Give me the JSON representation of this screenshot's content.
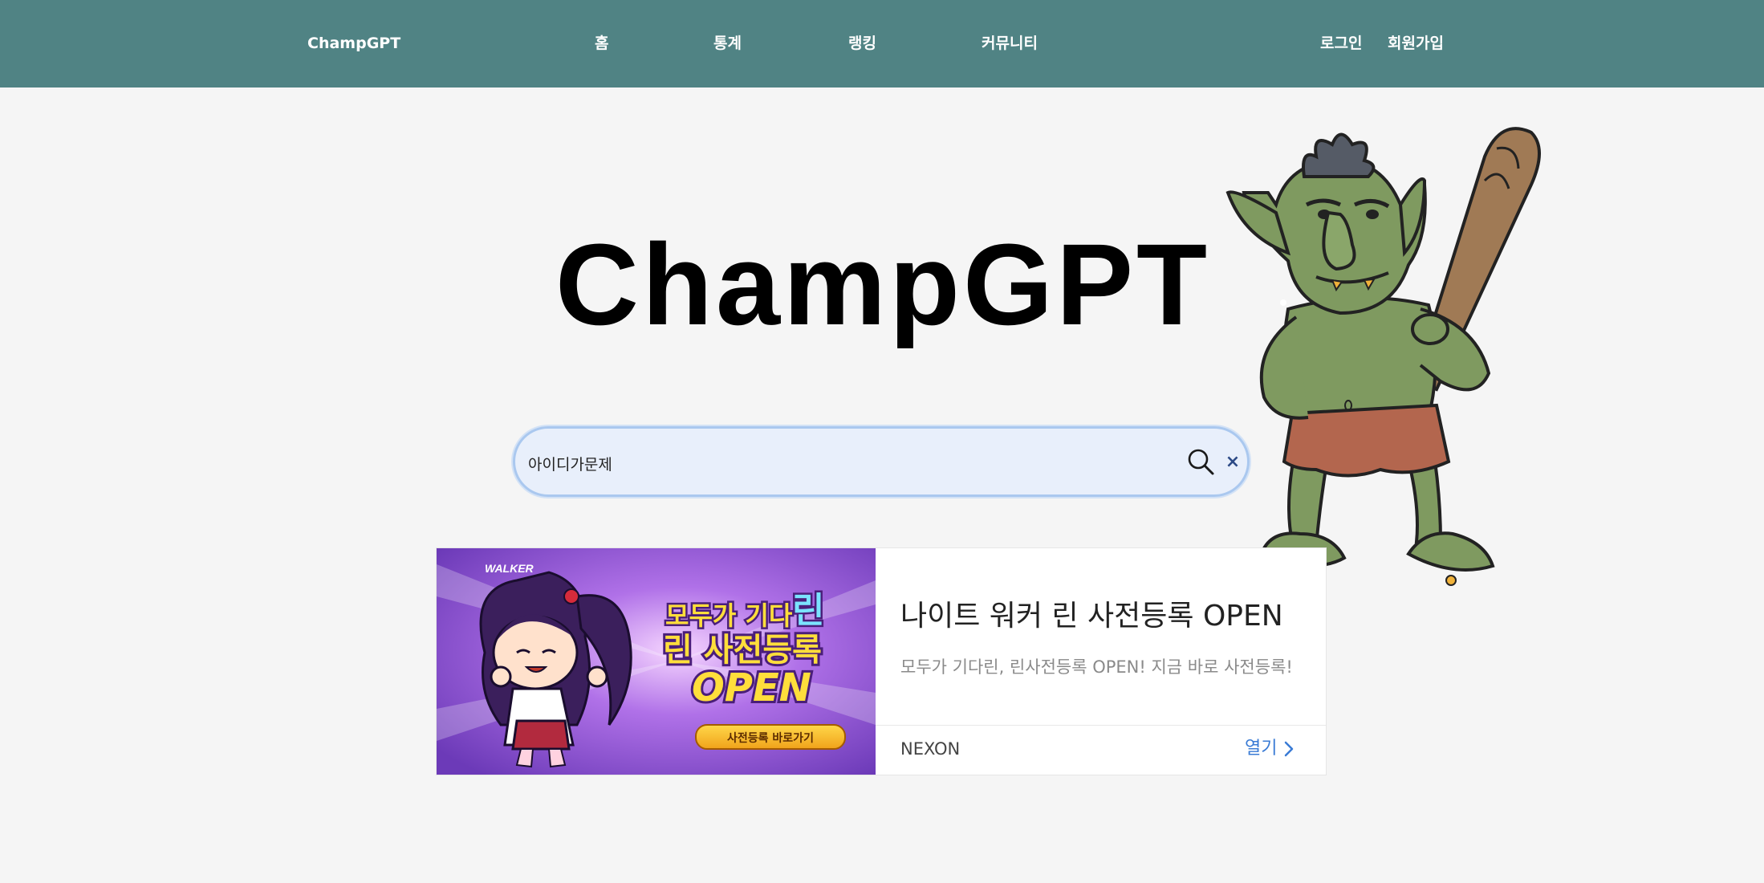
{
  "header": {
    "brand": "ChampGPT",
    "nav": [
      "홈",
      "통계",
      "랭킹",
      "커뮤니티"
    ],
    "login": "로그인",
    "signup": "회원가입"
  },
  "hero": {
    "title": "ChampGPT"
  },
  "search": {
    "value": "아이디가문제",
    "clear_label": "×"
  },
  "ad": {
    "image_logo": "WALKER",
    "image_line1": "모두가 기다",
    "image_line1_accent": "린",
    "image_line2": "린 사전등록",
    "image_line3": "OPEN",
    "image_button": "사전등록 바로가기",
    "headline": "나이트 워커 린 사전등록 OPEN",
    "description": "모두가 기다린, 린사전등록 OPEN! 지금 바로 사전등록!",
    "advertiser": "NEXON",
    "open_label": "열기"
  },
  "colors": {
    "header_bg": "#508384",
    "page_bg": "#f5f5f5",
    "search_bg": "#e8effb",
    "link_blue": "#3a7bd5"
  }
}
